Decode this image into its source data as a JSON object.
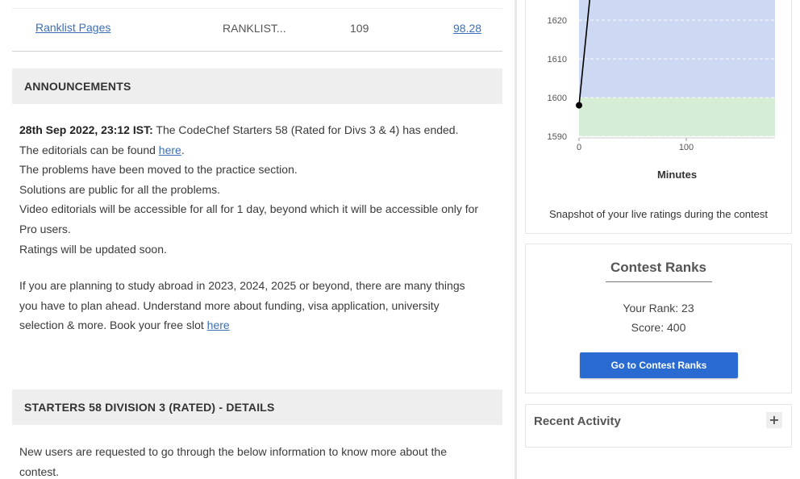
{
  "ranklist_row": {
    "link": "Ranklist Pages",
    "code": "RANKLIST...",
    "count": "109",
    "accuracy": "98.28"
  },
  "announcements": {
    "header": "ANNOUNCEMENTS",
    "date": "28th Sep 2022, 23:12 IST:",
    "line1": " The CodeChef Starters 58 (Rated for Divs 3 & 4) has ended.",
    "line2_prefix": "The editorials can be found ",
    "line2_link": "here",
    "line2_suffix": ".",
    "line3": "The problems have been moved to the practice section.",
    "line4": "Solutions are public for all the problems.",
    "line5": "Video editorials will be accessible for all for 1 day, beyond which it will be accessible only for",
    "line6": "Pro users.",
    "line7": "Ratings will be updated soon.",
    "study1": "If you are planning to study abroad in 2023, 2024, 2025 or beyond, there are many things",
    "study2": "you have to plan ahead. Understand more about funding, visa application, university",
    "study3_prefix": "selection & more. Book your free slot ",
    "study3_link": "here"
  },
  "details": {
    "header": "STARTERS 58 DIVISION 3 (RATED) - DETAILS",
    "line1": "New users are requested to go through the below information to know more about the",
    "line2": "contest."
  },
  "chart_data": {
    "type": "line",
    "xlabel": "Minutes",
    "ylabel": "",
    "x_ticks": [
      0,
      100
    ],
    "y_ticks": [
      1590,
      1600,
      1610,
      1620
    ],
    "ylim": [
      1590,
      1620
    ],
    "xlim": [
      0,
      180
    ],
    "bands": [
      {
        "from": 1590,
        "to": 1600,
        "color": "#d5ecd5"
      },
      {
        "from": 1600,
        "to": 1700,
        "color": "#cdd9f2"
      }
    ],
    "grid": true,
    "series": [
      {
        "x": [
          0,
          10
        ],
        "y": [
          1598,
          1650
        ],
        "color": "#000000"
      }
    ],
    "caption": "Snapshot of your live ratings during the contest"
  },
  "contest_ranks": {
    "title": "Contest Ranks",
    "your_rank": "Your Rank: 23",
    "score": "Score: 400",
    "button": "Go to Contest Ranks"
  },
  "recent_activity": {
    "title": "Recent Activity",
    "expand": "+"
  }
}
